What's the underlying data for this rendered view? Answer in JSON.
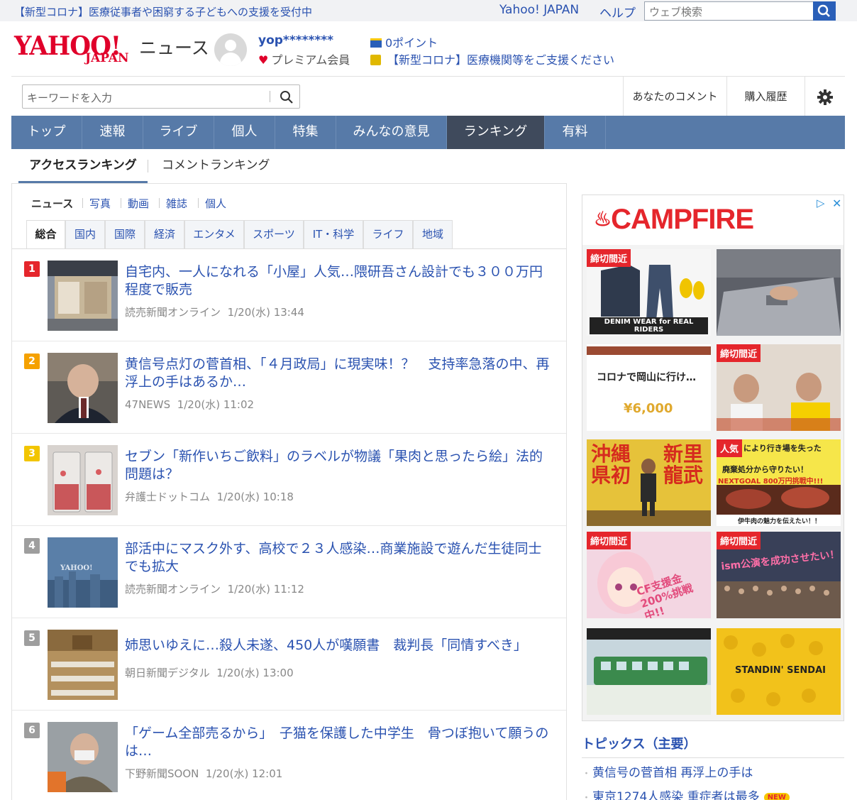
{
  "topbar": {
    "notice": "【新型コロナ】医療従事者や困窮する子どもへの支援を受付中",
    "yahoo_japan": "Yahoo! JAPAN",
    "help": "ヘルプ",
    "web_search_placeholder": "ウェブ検索"
  },
  "header": {
    "logo_main": "YAHOO!",
    "logo_sub": "JAPAN",
    "service": "ニュース",
    "username": "yop********",
    "membership": "プレミアム会員",
    "points": "0ポイント",
    "corona_link": "【新型コロナ】医療機関等をご支援ください"
  },
  "search": {
    "placeholder": "キーワードを入力",
    "your_comments": "あなたのコメント",
    "purchase_history": "購入履歴"
  },
  "nav": [
    "トップ",
    "速報",
    "ライブ",
    "個人",
    "特集",
    "みんなの意見",
    "ランキング",
    "有料"
  ],
  "ranking_tabs": {
    "access": "アクセスランキング",
    "comment": "コメントランキング"
  },
  "categories": [
    "ニュース",
    "写真",
    "動画",
    "雑誌",
    "個人"
  ],
  "genres": [
    "総合",
    "国内",
    "国際",
    "経済",
    "エンタメ",
    "スポーツ",
    "IT・科学",
    "ライフ",
    "地域"
  ],
  "articles": [
    {
      "rank": "1",
      "title": "自宅内、一人になれる「小屋」人気…隈研吾さん設計でも３００万円程度で販売",
      "source": "読売新聞オンライン",
      "time": "1/20(水) 13:44"
    },
    {
      "rank": "2",
      "title": "黄信号点灯の菅首相、「４月政局」に現実味！？　支持率急落の中、再浮上の手はあるか…",
      "source": "47NEWS",
      "time": "1/20(水) 11:02"
    },
    {
      "rank": "3",
      "title": "セブン「新作いちご飲料」のラベルが物議「果肉と思ったら絵」法的問題は？",
      "source": "弁護士ドットコム",
      "time": "1/20(水) 10:18"
    },
    {
      "rank": "4",
      "title": "部活中にマスク外す、高校で２３人感染…商業施設で遊んだ生徒同士でも拡大",
      "source": "読売新聞オンライン",
      "time": "1/20(水) 11:12"
    },
    {
      "rank": "5",
      "title": "姉思いゆえに…殺人未遂、450人が嘆願書　裁判長「同情すべき」",
      "source": "朝日新聞デジタル",
      "time": "1/20(水) 13:00"
    },
    {
      "rank": "6",
      "title": "「ゲーム全部売るから」　子猫を保護した中学生　骨つぼ抱いて願うのは…",
      "source": "下野新聞SOON",
      "time": "1/20(水) 12:01"
    }
  ],
  "rank_colors": [
    "#e5262c",
    "#f5a100",
    "#f2c500",
    "#9e9e9e",
    "#9e9e9e",
    "#9e9e9e"
  ],
  "ad": {
    "brand": "CAMPFIRE",
    "badge_deadline": "締切間近",
    "badge_popular": "人気",
    "tile_denim": "DENIM WEAR for REAL RIDERS",
    "tile_okayama": "コロナで岡山に行け…",
    "tile_price": "¥6,000",
    "tile_okinawa_left": "沖縄県初",
    "tile_okinawa_right": "新里龍武",
    "tile_beef_title": "により行き場を失った",
    "tile_beef_sub": "廃棄処分から守りたい！",
    "tile_beef_goal": "NEXTGOAL 800万円挑戦中!!!",
    "tile_beef_caption": "伊牛肉の魅力を伝えたい！！",
    "tile_cf": "CF支援金 200%挑戦中!!",
    "tile_ism": "ism公演を成功させたい！",
    "tile_sendai": "STANDIN' SENDAI"
  },
  "topics": {
    "heading": "トピックス（主要）",
    "items": [
      "黄信号の菅首相 再浮上の手は",
      "東京1274人感染 重症者は最多"
    ],
    "new_badge": "NEW"
  },
  "colors": {
    "nav": "#577aa8",
    "nav_active": "#3f4a5c",
    "link": "#2a52b0",
    "brand_red": "#e0002a"
  }
}
